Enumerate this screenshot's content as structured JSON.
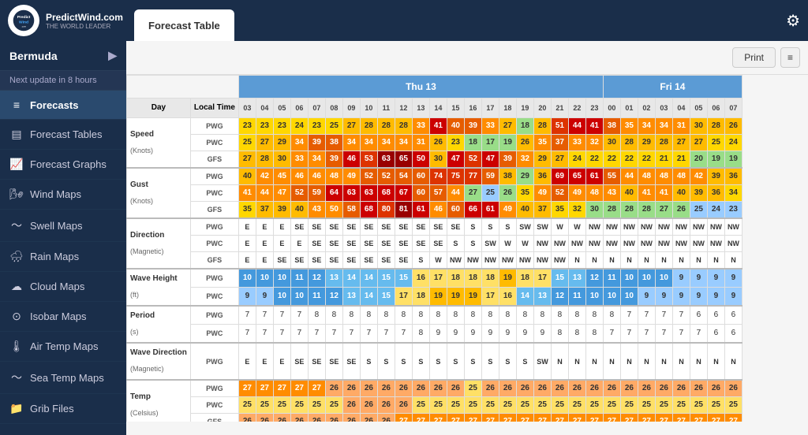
{
  "header": {
    "logo_alt": "PredictWind.com",
    "logo_tagline": "THE WORLD LEADER",
    "tab_label": "Forecast Table",
    "gear_icon": "⚙"
  },
  "sidebar": {
    "location": "Bermuda",
    "next_update": "Next update in 8 hours",
    "items": [
      {
        "id": "forecasts",
        "label": "Forecasts",
        "icon": "≡",
        "active": true
      },
      {
        "id": "forecast-tables",
        "label": "Forecast Tables",
        "icon": "▤"
      },
      {
        "id": "forecast-graphs",
        "label": "Forecast Graphs",
        "icon": "📈"
      },
      {
        "id": "wind-maps",
        "label": "Wind Maps",
        "icon": "🌬"
      },
      {
        "id": "swell-maps",
        "label": "Swell Maps",
        "icon": "🌊"
      },
      {
        "id": "rain-maps",
        "label": "Rain Maps",
        "icon": "🌧"
      },
      {
        "id": "cloud-maps",
        "label": "Cloud Maps",
        "icon": "☁"
      },
      {
        "id": "isobar-maps",
        "label": "Isobar Maps",
        "icon": "⊙"
      },
      {
        "id": "air-temp-maps",
        "label": "Air Temp Maps",
        "icon": "🌡"
      },
      {
        "id": "sea-temp-maps",
        "label": "Sea Temp Maps",
        "icon": "🌊"
      },
      {
        "id": "grib-files",
        "label": "Grib Files",
        "icon": "📁"
      }
    ]
  },
  "topbar": {
    "print_label": "Print",
    "menu_icon": "≡"
  },
  "table": {
    "days": [
      {
        "label": "Thu 13",
        "colspan": 21,
        "color": "thu"
      },
      {
        "label": "Fri 14",
        "colspan": 8,
        "color": "fri"
      }
    ],
    "times_thu": [
      "03",
      "04",
      "05",
      "06",
      "07",
      "08",
      "09",
      "10",
      "11",
      "12",
      "13",
      "14",
      "15",
      "16",
      "17",
      "18",
      "19",
      "20",
      "21",
      "22",
      "23"
    ],
    "times_fri": [
      "00",
      "01",
      "02",
      "03",
      "04",
      "05",
      "06",
      "07"
    ],
    "sections": [
      {
        "label": "Speed",
        "sublabel": "(Knots)",
        "rows": [
          {
            "source": "PWG",
            "values": [
              "23",
              "23",
              "23",
              "24",
              "23",
              "25",
              "27",
              "28",
              "28",
              "28",
              "33",
              "41",
              "40",
              "39",
              "33",
              "27",
              "18",
              "28",
              "51",
              "44",
              "41",
              "38",
              "35",
              "34",
              "34",
              "31",
              "30",
              "28",
              "26"
            ]
          },
          {
            "source": "PWC",
            "values": [
              "25",
              "27",
              "29",
              "34",
              "39",
              "38",
              "34",
              "34",
              "34",
              "34",
              "31",
              "26",
              "23",
              "18",
              "17",
              "19",
              "26",
              "35",
              "37",
              "33",
              "32",
              "30",
              "28",
              "29",
              "28",
              "27",
              "27",
              "25",
              "24"
            ]
          },
          {
            "source": "GFS",
            "values": [
              "27",
              "28",
              "30",
              "33",
              "34",
              "39",
              "46",
              "53",
              "63",
              "65",
              "50",
              "30",
              "47",
              "52",
              "47",
              "39",
              "32",
              "29",
              "27",
              "24",
              "22",
              "22",
              "22",
              "22",
              "21",
              "21",
              "20",
              "19",
              "19"
            ]
          }
        ]
      },
      {
        "label": "Gust",
        "sublabel": "(Knots)",
        "rows": [
          {
            "source": "PWG",
            "values": [
              "40",
              "42",
              "45",
              "46",
              "46",
              "48",
              "49",
              "52",
              "52",
              "54",
              "60",
              "74",
              "75",
              "77",
              "59",
              "38",
              "29",
              "36",
              "69",
              "65",
              "61",
              "55",
              "44",
              "48",
              "48",
              "48",
              "42",
              "39",
              "36"
            ]
          },
          {
            "source": "PWC",
            "values": [
              "41",
              "44",
              "47",
              "52",
              "59",
              "64",
              "63",
              "63",
              "68",
              "67",
              "60",
              "57",
              "44",
              "27",
              "25",
              "26",
              "35",
              "49",
              "52",
              "49",
              "48",
              "43",
              "40",
              "41",
              "41",
              "40",
              "39",
              "36",
              "34"
            ]
          },
          {
            "source": "GFS",
            "values": [
              "35",
              "37",
              "39",
              "40",
              "43",
              "50",
              "58",
              "68",
              "80",
              "81",
              "61",
              "46",
              "60",
              "66",
              "61",
              "49",
              "40",
              "37",
              "35",
              "32",
              "30",
              "28",
              "28",
              "28",
              "27",
              "26",
              "25",
              "24",
              "23"
            ]
          }
        ]
      },
      {
        "label": "Direction",
        "sublabel": "(Magnetic)",
        "rows": [
          {
            "source": "PWG",
            "values": [
              "E",
              "E",
              "E",
              "SE",
              "SE",
              "SE",
              "SE",
              "SE",
              "SE",
              "SE",
              "SE",
              "SE",
              "SE",
              "S",
              "S",
              "S",
              "SW",
              "SW",
              "W",
              "W",
              "NW",
              "NW",
              "NW",
              "NW",
              "NW",
              "NW",
              "NW",
              "NW",
              "NW"
            ]
          },
          {
            "source": "PWC",
            "values": [
              "E",
              "E",
              "E",
              "E",
              "SE",
              "SE",
              "SE",
              "SE",
              "SE",
              "SE",
              "SE",
              "SE",
              "S",
              "S",
              "SW",
              "W",
              "W",
              "NW",
              "NW",
              "NW",
              "NW",
              "NW",
              "NW",
              "NW",
              "NW",
              "NW",
              "NW",
              "NW",
              "NW"
            ]
          },
          {
            "source": "GFS",
            "values": [
              "E",
              "E",
              "SE",
              "SE",
              "SE",
              "SE",
              "SE",
              "SE",
              "SE",
              "SE",
              "S",
              "W",
              "NW",
              "NW",
              "NW",
              "NW",
              "NW",
              "NW",
              "NW",
              "N",
              "N",
              "N",
              "N",
              "N",
              "N",
              "N",
              "N",
              "N",
              "N"
            ]
          }
        ]
      },
      {
        "label": "Wave Height",
        "sublabel": "(ft)",
        "rows": [
          {
            "source": "PWG",
            "values": [
              "10",
              "10",
              "10",
              "11",
              "12",
              "13",
              "14",
              "14",
              "15",
              "15",
              "16",
              "17",
              "18",
              "18",
              "18",
              "19",
              "18",
              "17",
              "15",
              "13",
              "12",
              "11",
              "10",
              "10",
              "10",
              "9",
              "9",
              "9",
              "9"
            ]
          },
          {
            "source": "PWC",
            "values": [
              "9",
              "9",
              "10",
              "10",
              "11",
              "12",
              "13",
              "14",
              "15",
              "17",
              "18",
              "19",
              "19",
              "19",
              "17",
              "16",
              "14",
              "13",
              "12",
              "11",
              "10",
              "10",
              "10",
              "9",
              "9",
              "9",
              "9",
              "9",
              "9"
            ]
          }
        ]
      },
      {
        "label": "Period",
        "sublabel": "(s)",
        "rows": [
          {
            "source": "PWG",
            "values": [
              "7",
              "7",
              "7",
              "7",
              "8",
              "8",
              "8",
              "8",
              "8",
              "8",
              "8",
              "8",
              "8",
              "8",
              "8",
              "8",
              "8",
              "8",
              "8",
              "8",
              "8",
              "8",
              "7",
              "7",
              "7",
              "7",
              "6",
              "6",
              "6"
            ]
          },
          {
            "source": "PWC",
            "values": [
              "7",
              "7",
              "7",
              "7",
              "7",
              "7",
              "7",
              "7",
              "7",
              "7",
              "8",
              "9",
              "9",
              "9",
              "9",
              "9",
              "9",
              "9",
              "8",
              "8",
              "8",
              "7",
              "7",
              "7",
              "7",
              "7",
              "7",
              "6",
              "6"
            ]
          }
        ]
      },
      {
        "label": "Wave Direction",
        "sublabel": "(Magnetic)",
        "rows": [
          {
            "source": "PWG",
            "values": [
              "E",
              "E",
              "E",
              "SE",
              "SE",
              "SE",
              "SE",
              "S",
              "S",
              "S",
              "S",
              "S",
              "S",
              "S",
              "S",
              "S",
              "S",
              "SW",
              "N",
              "N",
              "N",
              "N",
              "N",
              "N",
              "N",
              "N",
              "N",
              "N",
              "N"
            ]
          }
        ]
      },
      {
        "label": "Temp",
        "sublabel": "(Celsius)",
        "rows": [
          {
            "source": "PWG",
            "values": [
              "27",
              "27",
              "27",
              "27",
              "27",
              "26",
              "26",
              "26",
              "26",
              "26",
              "26",
              "26",
              "26",
              "25",
              "26",
              "26",
              "26",
              "26",
              "26",
              "26",
              "26",
              "26",
              "26",
              "26",
              "26",
              "26",
              "26",
              "26",
              "26"
            ]
          },
          {
            "source": "PWC",
            "values": [
              "25",
              "25",
              "25",
              "25",
              "25",
              "25",
              "26",
              "26",
              "26",
              "26",
              "25",
              "25",
              "25",
              "25",
              "25",
              "25",
              "25",
              "25",
              "25",
              "25",
              "25",
              "25",
              "25",
              "25",
              "25",
              "25",
              "25",
              "25",
              "25"
            ]
          },
          {
            "source": "GFS",
            "values": [
              "26",
              "26",
              "26",
              "26",
              "26",
              "26",
              "26",
              "26",
              "26",
              "27",
              "27",
              "27",
              "27",
              "27",
              "27",
              "27",
              "27",
              "27",
              "27",
              "27",
              "27",
              "27",
              "27",
              "27",
              "27",
              "27",
              "27",
              "27",
              "27"
            ]
          }
        ]
      }
    ]
  }
}
